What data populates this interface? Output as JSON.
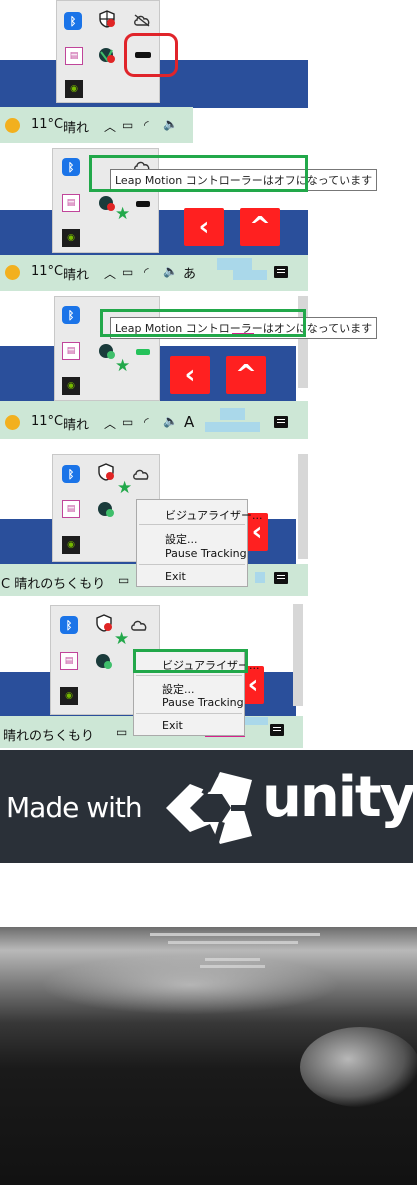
{
  "weather": {
    "temp": "11°C",
    "condition": "晴れ",
    "condition_long": "晴れのちくもり",
    "condition_cut": "C 晴れのちくもり"
  },
  "ime": {
    "hiragana": "あ",
    "latin": "A"
  },
  "tooltip": {
    "off_text": "Leap Motion コントローラーはオフになっています",
    "on_text": "Leap Motion コントローラーはオンになっています"
  },
  "context_menu": {
    "visualizer": "ビジュアライザー...",
    "settings": "設定...",
    "pause": "Pause Tracking",
    "exit": "Exit"
  },
  "nav_buttons": {
    "back": "‹",
    "up": "^"
  },
  "splash": {
    "made_with": "Made with",
    "brand": "unity"
  },
  "colors": {
    "taskbar": "#cde7d6",
    "desktop_blue": "#2a4f9b",
    "highlight_red": "#e0242a",
    "highlight_green": "#22a84a",
    "nav_red": "#ff2020",
    "unity_bg": "#2a3038"
  }
}
